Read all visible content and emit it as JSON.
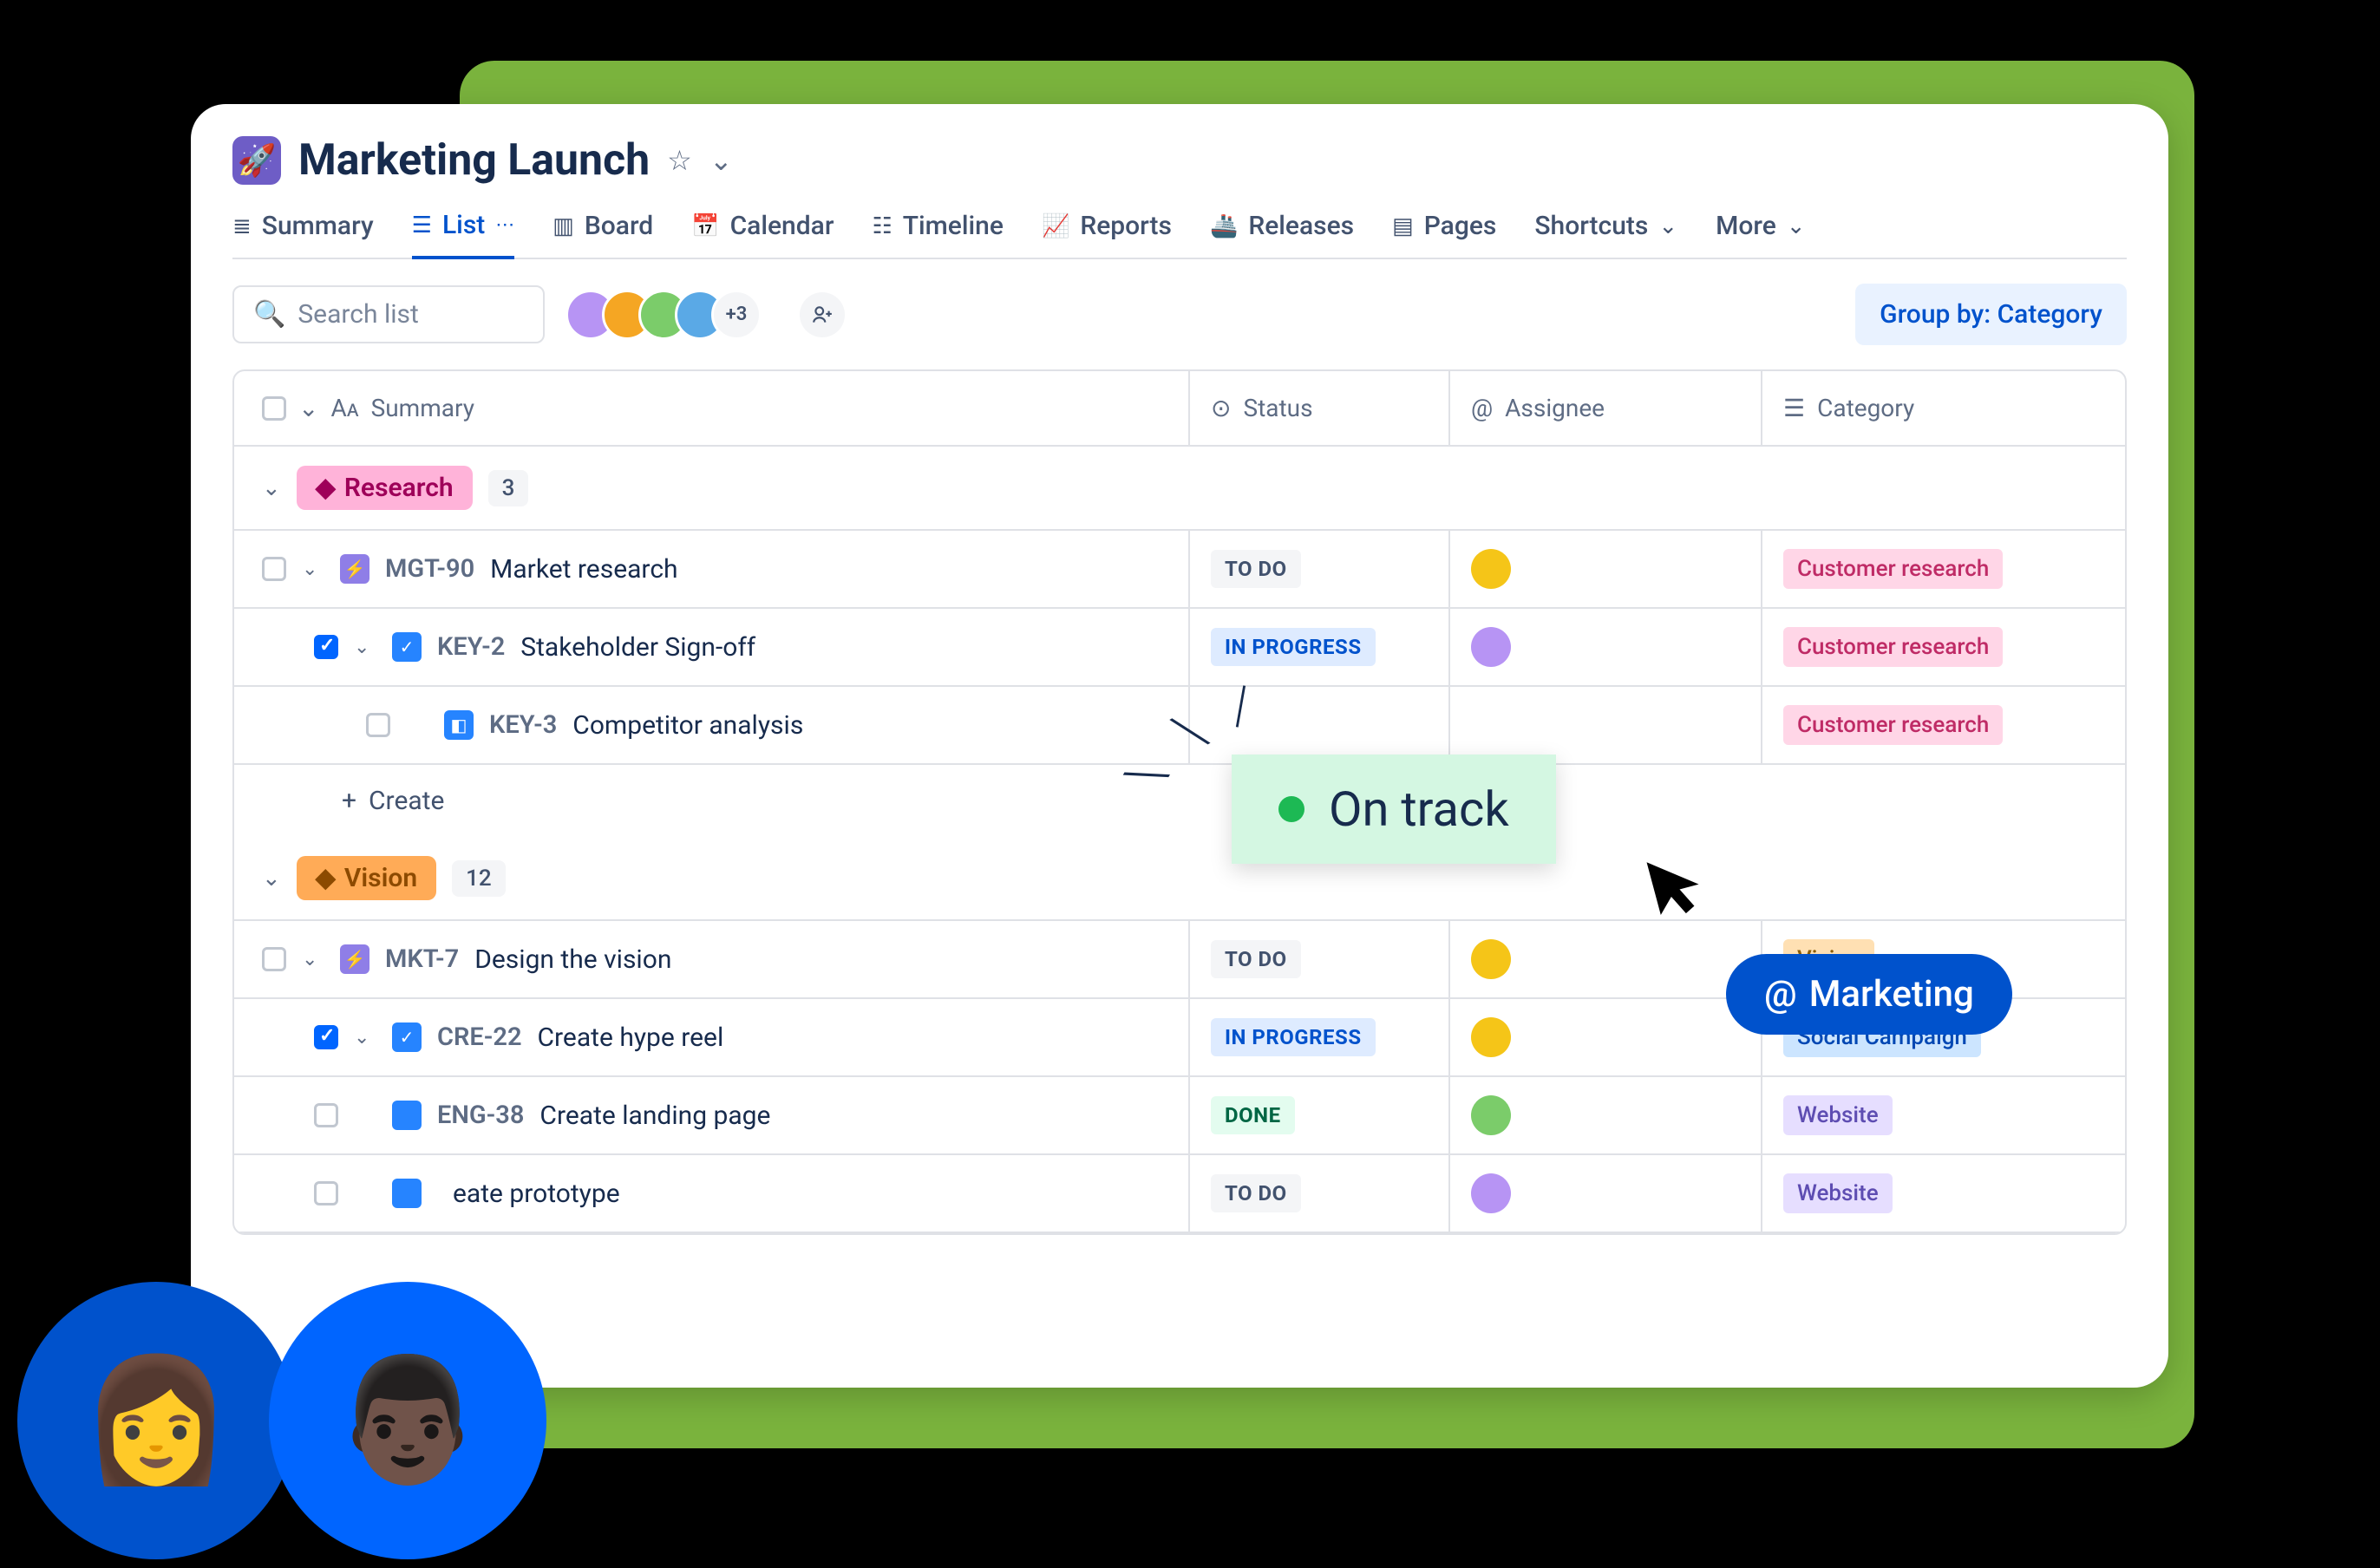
{
  "project": {
    "title": "Marketing Launch"
  },
  "tabs": {
    "summary": "Summary",
    "list": "List",
    "board": "Board",
    "calendar": "Calendar",
    "timeline": "Timeline",
    "reports": "Reports",
    "releases": "Releases",
    "pages": "Pages",
    "shortcuts": "Shortcuts",
    "more": "More"
  },
  "toolbar": {
    "search_placeholder": "Search list",
    "avatar_overflow": "+3",
    "groupby": "Group by: Category"
  },
  "columns": {
    "summary": "Summary",
    "status": "Status",
    "assignee": "Assignee",
    "category": "Category"
  },
  "groups": [
    {
      "name": "Research",
      "count": "3",
      "class": "g-research",
      "create": "Create",
      "rows": [
        {
          "indent": 0,
          "iconClass": "ic-epic",
          "iconGlyph": "⚡",
          "key": "MGT-90",
          "title": "Market research",
          "status": "TO DO",
          "statusClass": "s-todo",
          "avatarColor": "#f5c518",
          "category": "Customer research",
          "catClass": "c-cr",
          "hasChev": true,
          "checked": false
        },
        {
          "indent": 1,
          "iconClass": "ic-task",
          "iconGlyph": "✓",
          "key": "KEY-2",
          "title": "Stakeholder Sign-off",
          "status": "IN PROGRESS",
          "statusClass": "s-prog",
          "avatarColor": "#b794f4",
          "category": "Customer research",
          "catClass": "c-cr",
          "hasChev": true,
          "checked": true
        },
        {
          "indent": 2,
          "iconClass": "ic-task",
          "iconGlyph": "◧",
          "key": "KEY-3",
          "title": "Competitor analysis",
          "status": "",
          "statusClass": "",
          "avatarColor": "",
          "category": "Customer research",
          "catClass": "c-cr",
          "hasChev": false,
          "checked": false
        }
      ]
    },
    {
      "name": "Vision",
      "count": "12",
      "class": "g-vision",
      "rows": [
        {
          "indent": 0,
          "iconClass": "ic-epic",
          "iconGlyph": "⚡",
          "key": "MKT-7",
          "title": "Design the vision",
          "status": "TO DO",
          "statusClass": "s-todo",
          "avatarColor": "#f5c518",
          "category": "Vision",
          "catClass": "c-vis",
          "hasChev": true,
          "checked": false
        },
        {
          "indent": 1,
          "iconClass": "ic-task",
          "iconGlyph": "✓",
          "key": "CRE-22",
          "title": "Create hype reel",
          "status": "IN PROGRESS",
          "statusClass": "s-prog",
          "avatarColor": "#f5c518",
          "category": "Social Campaign",
          "catClass": "c-soc",
          "hasChev": true,
          "checked": true
        },
        {
          "indent": 1,
          "iconClass": "ic-task",
          "iconGlyph": "",
          "key": "ENG-38",
          "title": "Create landing page",
          "status": "DONE",
          "statusClass": "s-done",
          "avatarColor": "#7bcc6a",
          "category": "Website",
          "catClass": "c-web",
          "hasChev": false,
          "checked": false
        },
        {
          "indent": 1,
          "iconClass": "ic-task",
          "iconGlyph": "",
          "key": "",
          "title": "eate prototype",
          "status": "TO DO",
          "statusClass": "s-todo",
          "avatarColor": "#b794f4",
          "category": "Website",
          "catClass": "c-web",
          "hasChev": false,
          "checked": false
        }
      ]
    }
  ],
  "overlays": {
    "ontrack": "On track",
    "mention": "Marketing"
  }
}
